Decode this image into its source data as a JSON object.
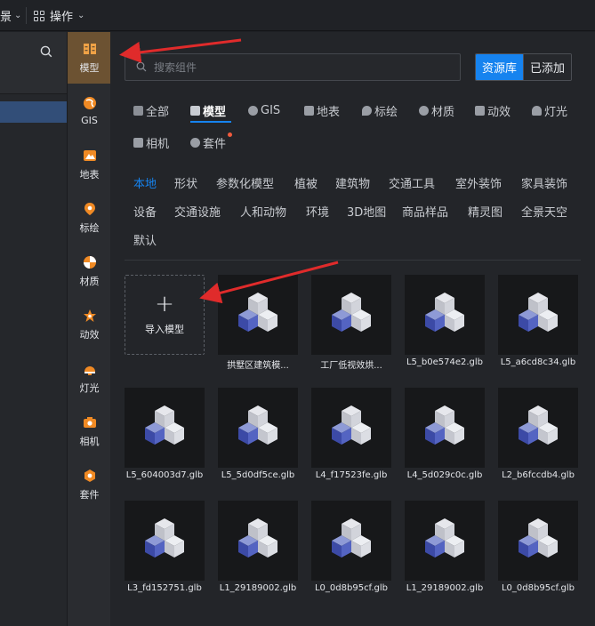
{
  "topbar": {
    "scene_menu_label": "景",
    "operate_menu_label": "操作"
  },
  "rail": {
    "items": [
      {
        "label": "模型",
        "icon": "model-icon",
        "active": true
      },
      {
        "label": "GIS",
        "icon": "gis-icon"
      },
      {
        "label": "地表",
        "icon": "terrain-icon"
      },
      {
        "label": "标绘",
        "icon": "marker-icon"
      },
      {
        "label": "材质",
        "icon": "material-icon"
      },
      {
        "label": "动效",
        "icon": "effect-icon"
      },
      {
        "label": "灯光",
        "icon": "light-icon"
      },
      {
        "label": "相机",
        "icon": "camera-icon"
      },
      {
        "label": "套件",
        "icon": "kit-icon"
      }
    ]
  },
  "search": {
    "placeholder": "搜索组件"
  },
  "segment": {
    "resource_label": "资源库",
    "added_label": "已添加"
  },
  "categories": [
    {
      "label": "全部"
    },
    {
      "label": "模型",
      "active": true
    },
    {
      "label": "GIS"
    },
    {
      "label": "地表"
    },
    {
      "label": "标绘"
    },
    {
      "label": "材质"
    },
    {
      "label": "动效"
    },
    {
      "label": "灯光"
    },
    {
      "label": "相机"
    },
    {
      "label": "套件",
      "badge": true
    }
  ],
  "subcategories": [
    {
      "label": "本地",
      "active": true
    },
    {
      "label": "形状"
    },
    {
      "label": "参数化模型"
    },
    {
      "label": "植被"
    },
    {
      "label": "建筑物"
    },
    {
      "label": "交通工具"
    },
    {
      "label": "室外装饰"
    },
    {
      "label": "家具装饰"
    },
    {
      "label": "设备"
    },
    {
      "label": "交通设施"
    },
    {
      "label": "人和动物"
    },
    {
      "label": "环境"
    },
    {
      "label": "3D地图"
    },
    {
      "label": "商品样品"
    },
    {
      "label": "精灵图"
    },
    {
      "label": "全景天空"
    },
    {
      "label": "默认"
    }
  ],
  "import_label": "导入模型",
  "assets": [
    {
      "name": "拱墅区建筑模..."
    },
    {
      "name": "工厂低视效烘..."
    },
    {
      "name": "L5_b0e574e2.glb"
    },
    {
      "name": "L5_a6cd8c34.glb"
    },
    {
      "name": "L5_604003d7.glb"
    },
    {
      "name": "L5_5d0df5ce.glb"
    },
    {
      "name": "L4_f17523fe.glb"
    },
    {
      "name": "L4_5d029c0c.glb"
    },
    {
      "name": "L2_b6fccdb4.glb"
    },
    {
      "name": "L3_fd152751.glb"
    },
    {
      "name": "L1_29189002.glb"
    },
    {
      "name": "L0_0d8b95cf.glb"
    },
    {
      "name": "L1_29189002.glb"
    },
    {
      "name": "L0_0d8b95cf.glb"
    }
  ],
  "colors": {
    "accent": "#1683ef",
    "rail_active": "#6c5232",
    "annotation_arrow": "#e02b2b"
  }
}
